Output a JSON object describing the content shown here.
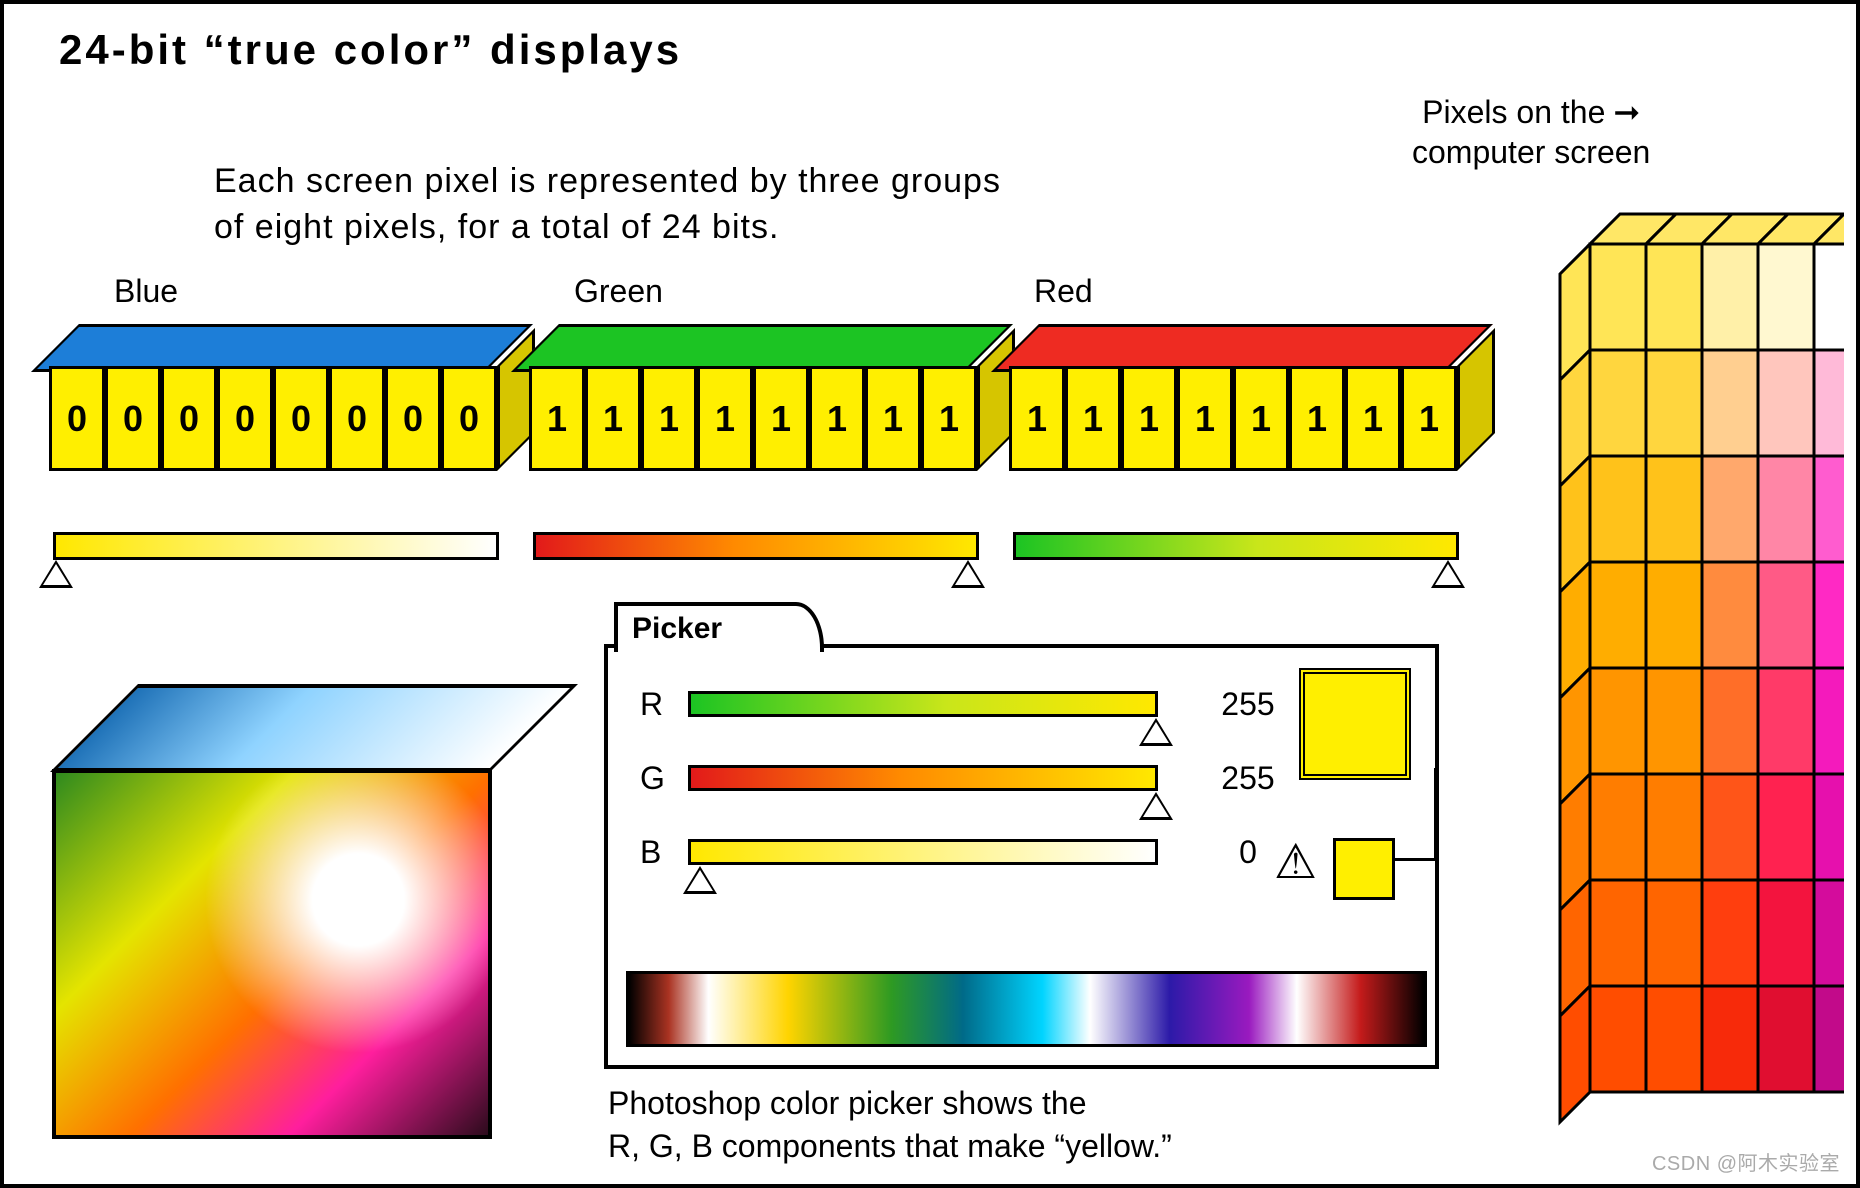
{
  "title": "24-bit “true color” displays",
  "subtitle_l1": "Each screen pixel is represented by three groups",
  "subtitle_l2": "of eight pixels, for a total of 24 bits.",
  "channels": [
    {
      "name": "Blue",
      "top_color": "#1d7ed8",
      "bits": [
        "0",
        "0",
        "0",
        "0",
        "0",
        "0",
        "0",
        "0"
      ],
      "grad_css": "linear-gradient(90deg,#ffe800 0%, #fff 100%)",
      "tri_side": "left"
    },
    {
      "name": "Green",
      "top_color": "#1cc423",
      "bits": [
        "1",
        "1",
        "1",
        "1",
        "1",
        "1",
        "1",
        "1"
      ],
      "grad_css": "linear-gradient(90deg,#e21a1a 0%, #ff8a00 45%, #ffe800 100%)",
      "tri_side": "right"
    },
    {
      "name": "Red",
      "top_color": "#ee2b22",
      "bits": [
        "1",
        "1",
        "1",
        "1",
        "1",
        "1",
        "1",
        "1"
      ],
      "grad_css": "linear-gradient(90deg,#1cc423 0%, #c9e61a 55%, #ffe800 100%)",
      "tri_side": "right"
    }
  ],
  "picker": {
    "tab": "Picker",
    "rows": [
      {
        "label": "R",
        "value": "255",
        "slider_css": "linear-gradient(90deg,#1cc423 0%, #c9e61a 55%, #ffe800 100%)",
        "tri": "right"
      },
      {
        "label": "G",
        "value": "255",
        "slider_css": "linear-gradient(90deg,#e21a1a 0%, #ff8a00 45%, #ffe800 100%)",
        "tri": "right"
      },
      {
        "label": "B",
        "value": "0",
        "slider_css": "linear-gradient(90deg,#ffe800 0%, #fff 100%)",
        "tri": "left"
      }
    ],
    "swatch": "#ffef00",
    "caption_l1": "Photoshop color picker shows the",
    "caption_l2": "R, G, B components that make “yellow.”"
  },
  "screen_label_l1": "Pixels on the",
  "screen_label_l2": "computer screen",
  "pixel_wall_rows": [
    [
      "#ffe556",
      "#fff0a8",
      "#fff8d0",
      "#ffffff"
    ],
    [
      "#ffd63e",
      "#ffcf90",
      "#ffc6bd",
      "#ffbad8"
    ],
    [
      "#ffc21a",
      "#ffa86c",
      "#ff86a6",
      "#ff5ccf"
    ],
    [
      "#ffad00",
      "#ff8b3e",
      "#ff5a86",
      "#ff29c4"
    ],
    [
      "#ff9500",
      "#ff6e28",
      "#ff3a68",
      "#f41abc"
    ],
    [
      "#ff7d00",
      "#ff5518",
      "#ff2250",
      "#e610ad"
    ],
    [
      "#ff6500",
      "#ff3e0e",
      "#f3143e",
      "#d40c9c"
    ],
    [
      "#ff4d00",
      "#f72a0a",
      "#e00e30",
      "#c20a8a"
    ]
  ],
  "watermark": "CSDN @阿木实验室"
}
